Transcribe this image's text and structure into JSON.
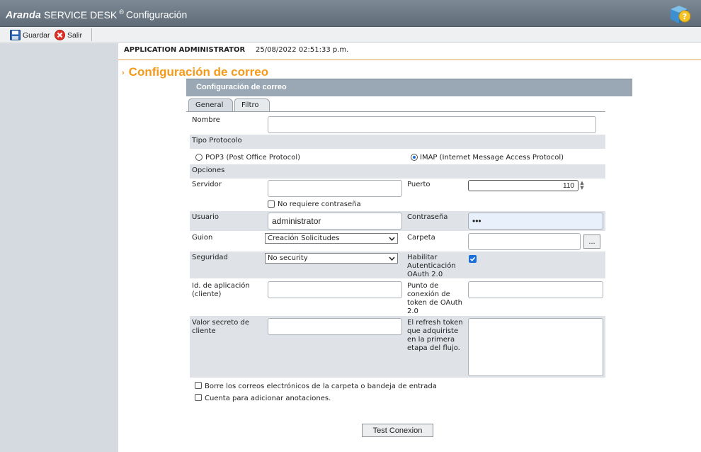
{
  "header": {
    "brand_bold": "Aranda",
    "brand_product": "SERVICE DESK",
    "registered": "®",
    "module": "Configuración"
  },
  "toolbar": {
    "save_label": "Guardar",
    "exit_label": "Salir"
  },
  "userbar": {
    "user": "APPLICATION ADMINISTRATOR",
    "datetime": "25/08/2022 02:51:33 p.m."
  },
  "page": {
    "title": "Configuración de correo",
    "panel_title": "Configuración de correo"
  },
  "tabs": [
    {
      "label": "General",
      "active": true
    },
    {
      "label": "Filtro",
      "active": false
    }
  ],
  "form": {
    "nombre_label": "Nombre",
    "nombre_value": "",
    "tipo_protocolo_label": "Tipo Protocolo",
    "pop3_label": "POP3 (Post Office Protocol)",
    "pop3_selected": false,
    "imap_label": "IMAP (Internet Message Access Protocol)",
    "imap_selected": true,
    "opciones_label": "Opciones",
    "servidor_label": "Servidor",
    "servidor_value": "",
    "puerto_label": "Puerto",
    "puerto_value": "110",
    "no_password_label": "No requiere contraseña",
    "no_password_checked": false,
    "usuario_label": "Usuario",
    "usuario_value": "administrator",
    "contrasena_label": "Contraseña",
    "contrasena_value": "•••",
    "guion_label": "Guion",
    "guion_value": "Creación Solicitudes",
    "carpeta_label": "Carpeta",
    "carpeta_value": "",
    "carpeta_browse": "...",
    "seguridad_label": "Seguridad",
    "seguridad_value": "No security",
    "oauth_label_1": "Habilitar",
    "oauth_label_2": "Autenticación",
    "oauth_label_3": "OAuth 2.0",
    "oauth_checked": true,
    "app_id_label_1": "Id. de aplicación",
    "app_id_label_2": "(cliente)",
    "app_id_value": "",
    "token_label_1": "Punto de",
    "token_label_2": "conexión de",
    "token_label_3": "token de OAuth",
    "token_label_4": "2.0",
    "token_value": "",
    "secret_label_1": "Valor secreto de",
    "secret_label_2": "cliente",
    "secret_value": "",
    "refresh_label_1": "El refresh token",
    "refresh_label_2": "que adquiriste",
    "refresh_label_3": "en la primera",
    "refresh_label_4": "etapa del flujo.",
    "refresh_value": "",
    "delete_mail_label": "Borre los correos electrónicos de la carpeta o bandeja de entrada",
    "delete_mail_checked": false,
    "annotations_label": "Cuenta para adicionar anotaciones.",
    "annotations_checked": false,
    "test_button": "Test Conexion"
  },
  "colors": {
    "accent": "#f39a1a",
    "panel_header": "#9aa8b5",
    "sidebar": "#d4dae0",
    "row_bg": "#dfe3e7",
    "check_blue": "#1a6ed8"
  },
  "icons": {
    "save": "floppy-disk-icon",
    "exit": "close-circle-icon",
    "help": "help-cube-icon",
    "stepper": "spin-arrows-icon",
    "dropdown": "chevron-down-icon"
  }
}
